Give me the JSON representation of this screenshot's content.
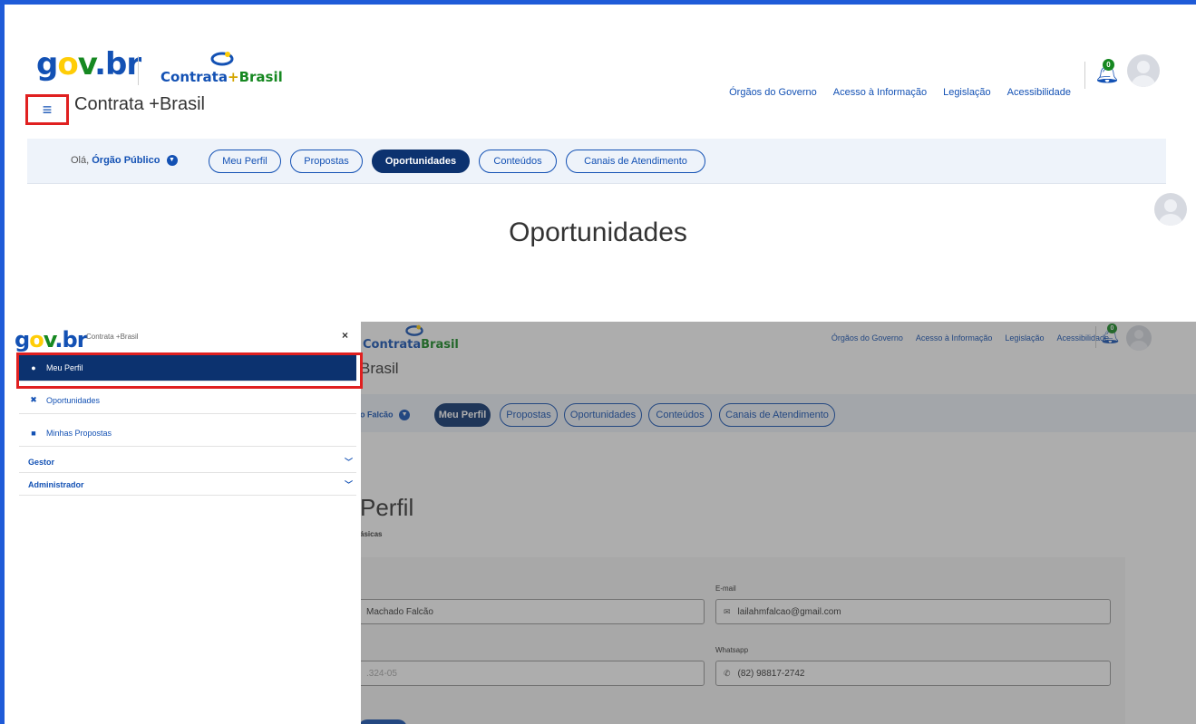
{
  "header": {
    "logo_gov": "gov.br",
    "logo_contrata": "Contrata",
    "logo_plus": "+",
    "logo_brasil": "Brasil",
    "app_title": "Contrata +Brasil",
    "links": [
      "Órgãos do Governo",
      "Acesso à Informação",
      "Legislação",
      "Acessibilidade"
    ],
    "notification_count": "0"
  },
  "subnav": {
    "greeting_prefix": "Olá,",
    "greeting_name": "Órgão Público",
    "tabs": [
      "Meu Perfil",
      "Propostas",
      "Oportunidades",
      "Conteúdos",
      "Canais de Atendimento"
    ],
    "active_tab": "Oportunidades"
  },
  "page": {
    "heading": "Oportunidades"
  },
  "sidebar": {
    "app_name": "Contrata +Brasil",
    "close": "×",
    "items": [
      {
        "label": "Meu Perfil",
        "icon": "user-icon"
      },
      {
        "label": "Oportunidades",
        "icon": "tools-icon"
      },
      {
        "label": "Minhas Propostas",
        "icon": "briefcase-icon"
      }
    ],
    "groups": [
      "Gestor",
      "Administrador"
    ]
  },
  "profile_screen": {
    "logo_contrata": "Contrata",
    "logo_brasil": "Brasil",
    "title_fragment": "Brasil",
    "greeting_fragment": "o Falcão",
    "tabs": [
      "Meu Perfil",
      "Propostas",
      "Oportunidades",
      "Conteúdos",
      "Canais de Atendimento"
    ],
    "active_tab": "Meu Perfil",
    "links": [
      "Órgãos do Governo",
      "Acesso à Informação",
      "Legislação",
      "Acessibilidade"
    ],
    "notification_count": "0",
    "heading": "Perfil",
    "section_fragment": "ásicas",
    "email_label": "E-mail",
    "email_value": "lailahmfalcao@gmail.com",
    "name_value": "Machado Falcão",
    "whatsapp_label": "Whatsapp",
    "whatsapp_value": "(82) 98817-2742",
    "cpf_fragment": ".324-05"
  },
  "colors": {
    "brand_blue": "#1351b4",
    "dark_blue": "#0c326f",
    "govbr_green": "#168821",
    "govbr_yellow": "#ffcd07",
    "highlight_red": "#e02020",
    "frame_blue": "#1f5bd8"
  }
}
